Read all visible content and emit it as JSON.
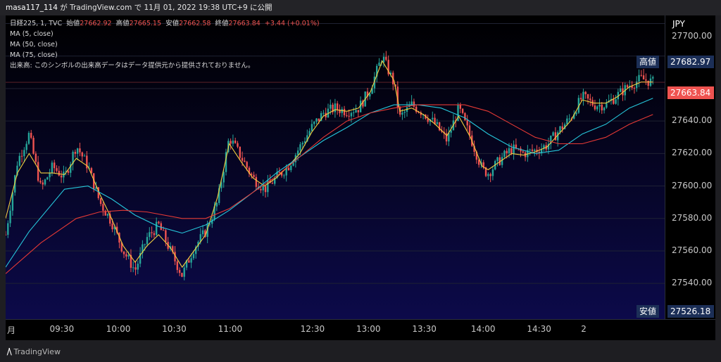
{
  "header": {
    "user": "masa117_114",
    "text": "が TradingView.com で 11月 01, 2022 19:38 UTC+9 に公開"
  },
  "legend": {
    "symbol": "日経225, 1, TVC",
    "open_label": "始値",
    "open": "27662.92",
    "high_label": "高値",
    "high": "27665.15",
    "low_label": "安値",
    "low": "27662.58",
    "close_label": "終値",
    "close": "27663.84",
    "change": "+3.44 (+0.01%)",
    "ma1": "MA (5, close)",
    "ma2": "MA (50, close)",
    "ma3": "MA (75, close)",
    "volume_note": "出来高: このシンボルの出来高データはデータ提供元から提供されておりません。"
  },
  "price_axis": {
    "currency": "JPY",
    "top_partial": "27700.00",
    "high_badge": {
      "label": "高値",
      "value": "27682.97"
    },
    "last_badge": {
      "value": "27663.84"
    },
    "low_badge": {
      "label": "安値",
      "value": "27526.18"
    }
  },
  "brand": {
    "name": "TradingView"
  },
  "colors": {
    "up": "#26a69a",
    "down": "#ef5350",
    "ma5": "#f4d03f",
    "ma50": "#26c6da",
    "ma75": "#e53935",
    "badge_bg": "#1c2f57",
    "last_bg": "#ef5350"
  },
  "chart_data": {
    "type": "line",
    "symbol": "日経225",
    "y_ticks": [
      27540,
      27560,
      27580,
      27600,
      27620,
      27640
    ],
    "x_ticks": [
      "月",
      "09:30",
      "10:00",
      "10:30",
      "11:00",
      "12:30",
      "13:00",
      "13:30",
      "14:00",
      "14:30",
      "2"
    ],
    "ylim": [
      27518,
      27705
    ],
    "close_path": [
      [
        0,
        27570
      ],
      [
        2,
        27615
      ],
      [
        4,
        27632
      ],
      [
        6,
        27598
      ],
      [
        8,
        27612
      ],
      [
        10,
        27605
      ],
      [
        12,
        27625
      ],
      [
        14,
        27612
      ],
      [
        16,
        27590
      ],
      [
        18,
        27578
      ],
      [
        20,
        27560
      ],
      [
        22,
        27548
      ],
      [
        24,
        27568
      ],
      [
        26,
        27576
      ],
      [
        28,
        27560
      ],
      [
        30,
        27545
      ],
      [
        32,
        27562
      ],
      [
        34,
        27572
      ],
      [
        36,
        27590
      ],
      [
        38,
        27630
      ],
      [
        40,
        27618
      ],
      [
        42,
        27605
      ],
      [
        44,
        27598
      ],
      [
        46,
        27605
      ],
      [
        48,
        27612
      ],
      [
        50,
        27624
      ],
      [
        52,
        27636
      ],
      [
        54,
        27645
      ],
      [
        56,
        27648
      ],
      [
        58,
        27646
      ],
      [
        60,
        27648
      ],
      [
        62,
        27660
      ],
      [
        64,
        27680
      ],
      [
        66,
        27663
      ],
      [
        67,
        27642
      ],
      [
        69,
        27650
      ],
      [
        71,
        27645
      ],
      [
        73,
        27638
      ],
      [
        75,
        27628
      ],
      [
        77,
        27648
      ],
      [
        79,
        27630
      ],
      [
        81,
        27610
      ],
      [
        82,
        27608
      ],
      [
        84,
        27616
      ],
      [
        86,
        27623
      ],
      [
        88,
        27620
      ],
      [
        90,
        27622
      ],
      [
        92,
        27625
      ],
      [
        94,
        27634
      ],
      [
        96,
        27642
      ],
      [
        98,
        27655
      ],
      [
        100,
        27650
      ],
      [
        102,
        27650
      ],
      [
        104,
        27656
      ],
      [
        106,
        27662
      ],
      [
        108,
        27666
      ],
      [
        110,
        27663.84
      ]
    ],
    "series": [
      {
        "name": "MA (5, close)",
        "values": [
          [
            0,
            27580
          ],
          [
            2,
            27608
          ],
          [
            4,
            27620
          ],
          [
            6,
            27608
          ],
          [
            8,
            27608
          ],
          [
            10,
            27607
          ],
          [
            12,
            27617
          ],
          [
            14,
            27612
          ],
          [
            16,
            27595
          ],
          [
            18,
            27580
          ],
          [
            20,
            27563
          ],
          [
            22,
            27553
          ],
          [
            24,
            27563
          ],
          [
            26,
            27570
          ],
          [
            28,
            27562
          ],
          [
            30,
            27550
          ],
          [
            32,
            27560
          ],
          [
            34,
            27570
          ],
          [
            36,
            27593
          ],
          [
            38,
            27626
          ],
          [
            40,
            27615
          ],
          [
            42,
            27605
          ],
          [
            44,
            27600
          ],
          [
            46,
            27605
          ],
          [
            48,
            27612
          ],
          [
            50,
            27620
          ],
          [
            52,
            27633
          ],
          [
            54,
            27643
          ],
          [
            56,
            27647
          ],
          [
            58,
            27646
          ],
          [
            60,
            27648
          ],
          [
            62,
            27658
          ],
          [
            64,
            27677
          ],
          [
            66,
            27665
          ],
          [
            67,
            27646
          ],
          [
            69,
            27648
          ],
          [
            71,
            27644
          ],
          [
            73,
            27638
          ],
          [
            75,
            27631
          ],
          [
            77,
            27643
          ],
          [
            79,
            27630
          ],
          [
            81,
            27612
          ],
          [
            82,
            27610
          ],
          [
            84,
            27615
          ],
          [
            86,
            27620
          ],
          [
            88,
            27619
          ],
          [
            90,
            27621
          ],
          [
            92,
            27624
          ],
          [
            94,
            27632
          ],
          [
            96,
            27640
          ],
          [
            98,
            27653
          ],
          [
            100,
            27651
          ],
          [
            102,
            27651
          ],
          [
            104,
            27655
          ],
          [
            106,
            27661
          ],
          [
            108,
            27664
          ],
          [
            110,
            27664
          ]
        ]
      },
      {
        "name": "MA (50, close)",
        "values": [
          [
            0,
            27550
          ],
          [
            4,
            27572
          ],
          [
            10,
            27598
          ],
          [
            14,
            27600
          ],
          [
            18,
            27592
          ],
          [
            22,
            27582
          ],
          [
            26,
            27575
          ],
          [
            30,
            27571
          ],
          [
            34,
            27576
          ],
          [
            38,
            27585
          ],
          [
            42,
            27596
          ],
          [
            46,
            27608
          ],
          [
            50,
            27618
          ],
          [
            54,
            27628
          ],
          [
            58,
            27636
          ],
          [
            62,
            27645
          ],
          [
            66,
            27650
          ],
          [
            70,
            27650
          ],
          [
            74,
            27648
          ],
          [
            78,
            27642
          ],
          [
            82,
            27632
          ],
          [
            86,
            27624
          ],
          [
            90,
            27620
          ],
          [
            94,
            27622
          ],
          [
            98,
            27632
          ],
          [
            102,
            27638
          ],
          [
            106,
            27648
          ],
          [
            110,
            27654
          ]
        ]
      },
      {
        "name": "MA (75, close)",
        "values": [
          [
            0,
            27546
          ],
          [
            6,
            27565
          ],
          [
            12,
            27580
          ],
          [
            16,
            27584
          ],
          [
            20,
            27585
          ],
          [
            24,
            27584
          ],
          [
            30,
            27580
          ],
          [
            34,
            27580
          ],
          [
            38,
            27586
          ],
          [
            42,
            27596
          ],
          [
            46,
            27606
          ],
          [
            50,
            27618
          ],
          [
            54,
            27630
          ],
          [
            58,
            27640
          ],
          [
            62,
            27645
          ],
          [
            66,
            27648
          ],
          [
            70,
            27650
          ],
          [
            74,
            27650
          ],
          [
            78,
            27650
          ],
          [
            82,
            27646
          ],
          [
            86,
            27638
          ],
          [
            90,
            27630
          ],
          [
            94,
            27626
          ],
          [
            98,
            27626
          ],
          [
            102,
            27630
          ],
          [
            106,
            27638
          ],
          [
            110,
            27644
          ]
        ]
      }
    ],
    "candles_summary": {
      "high": 27682.97,
      "low": 27526.18,
      "last": 27663.84
    }
  }
}
